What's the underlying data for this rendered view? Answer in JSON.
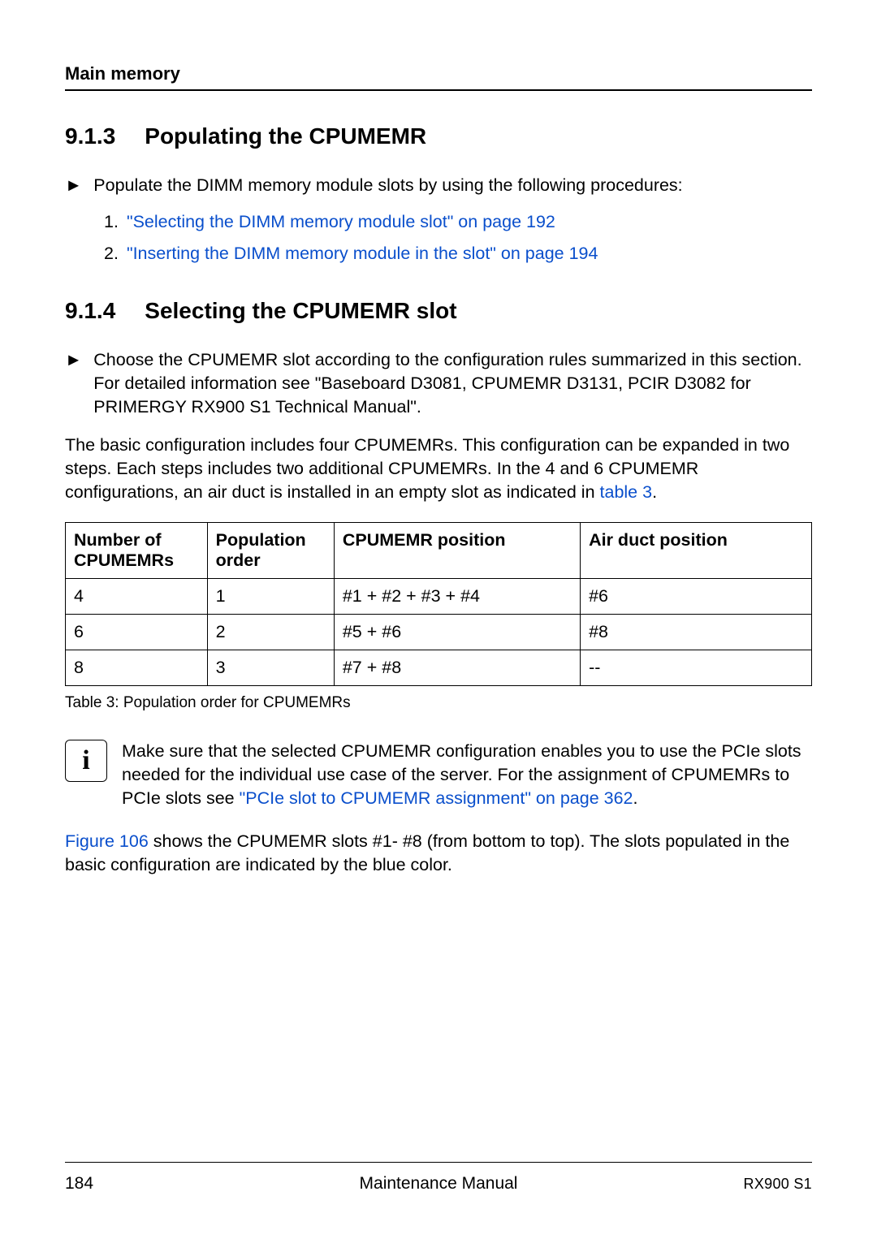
{
  "header": {
    "title": "Main memory"
  },
  "section1": {
    "number": "9.1.3",
    "title": "Populating the CPUMEMR",
    "intro": "Populate the DIMM memory module slots by using the following procedures:",
    "items": [
      {
        "num": "1.",
        "text": "\"Selecting the DIMM memory module slot\" on page 192"
      },
      {
        "num": "2.",
        "text": "\"Inserting the DIMM memory module in the slot\" on page 194"
      }
    ]
  },
  "section2": {
    "number": "9.1.4",
    "title": "Selecting the CPUMEMR slot",
    "bullet": "Choose the CPUMEMR slot according to the configuration rules summarized in this section. For detailed information see \"Baseboard D3081, CPUMEMR D3131, PCIR D3082 for PRIMERGY RX900 S1 Technical Manual\".",
    "para1_a": "The basic configuration includes four CPUMEMRs. This configuration can be expanded in two steps. Each steps includes two additional CPUMEMRs. In the 4 and 6 CPUMEMR configurations, an air duct is installed in an empty slot as indicated in ",
    "para1_link": "table 3",
    "para1_b": "."
  },
  "table": {
    "headers": [
      "Number of CPUMEMRs",
      "Population order",
      "CPUMEMR position",
      "Air duct position"
    ],
    "rows": [
      {
        "c0": "4",
        "c1": "1",
        "c2": "#1 + #2 + #3 + #4",
        "c3": "#6"
      },
      {
        "c0": "6",
        "c1": "2",
        "c2": "#5 + #6",
        "c3": "#8"
      },
      {
        "c0": "8",
        "c1": "3",
        "c2": "#7 + #8",
        "c3": "--"
      }
    ],
    "caption": "Table 3: Population order for CPUMEMRs"
  },
  "info": {
    "text_a": "Make sure that the selected CPUMEMR configuration enables you to use the PCIe slots needed for the individual use case of the server. For the assignment of CPUMEMRs to PCIe slots see ",
    "link": "\"PCIe slot to CPUMEMR assignment\" on page 362",
    "text_b": "."
  },
  "closing": {
    "link": "Figure 106",
    "rest": " shows the CPUMEMR slots #1- #8 (from bottom to top). The slots populated in the basic configuration are indicated by the blue color."
  },
  "footer": {
    "page": "184",
    "center": "Maintenance Manual",
    "right": "RX900 S1"
  },
  "icons": {
    "info": "i"
  }
}
